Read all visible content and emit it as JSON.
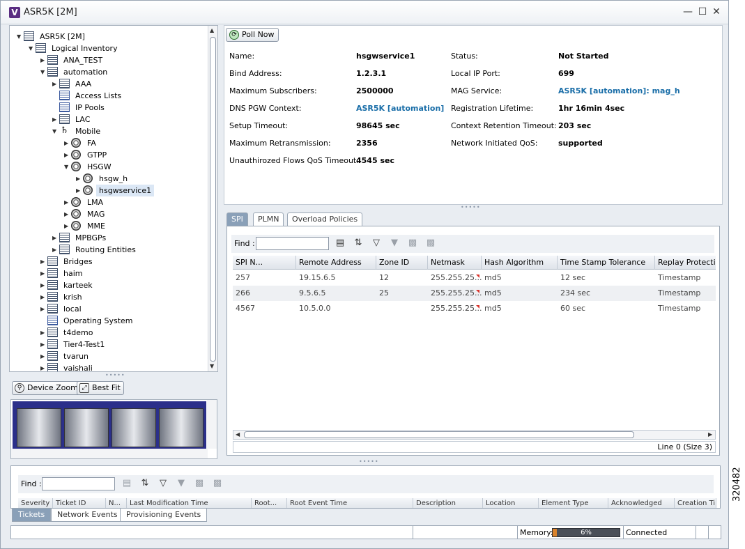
{
  "window": {
    "title": "ASR5K [2M]",
    "app_icon": "V"
  },
  "tree": {
    "items": [
      {
        "label": "ASR5K [2M]",
        "level": 0,
        "expanded": true,
        "icon": "device-icon"
      },
      {
        "label": "Logical Inventory",
        "level": 1,
        "expanded": true,
        "icon": "inventory-icon"
      },
      {
        "label": "ANA_TEST",
        "level": 2,
        "expanded": false,
        "icon": "context-icon"
      },
      {
        "label": "automation",
        "level": 2,
        "expanded": true,
        "icon": "context-icon"
      },
      {
        "label": "AAA",
        "level": 3,
        "expanded": false,
        "icon": "aaa-icon"
      },
      {
        "label": "Access Lists",
        "level": 3,
        "icon": "list-icon"
      },
      {
        "label": "IP Pools",
        "level": 3,
        "icon": "list-icon"
      },
      {
        "label": "LAC",
        "level": 3,
        "expanded": false,
        "icon": "context-icon"
      },
      {
        "label": "Mobile",
        "level": 3,
        "expanded": true,
        "icon": "mobile-icon"
      },
      {
        "label": "FA",
        "level": 4,
        "expanded": false,
        "icon": "service-icon"
      },
      {
        "label": "GTPP",
        "level": 4,
        "expanded": false,
        "icon": "service-icon"
      },
      {
        "label": "HSGW",
        "level": 4,
        "expanded": true,
        "icon": "service-icon"
      },
      {
        "label": "hsgw_h",
        "level": 5,
        "expanded": false,
        "icon": "service-icon"
      },
      {
        "label": "hsgwservice1",
        "level": 5,
        "expanded": false,
        "icon": "service-icon",
        "selected": true
      },
      {
        "label": "LMA",
        "level": 4,
        "expanded": false,
        "icon": "service-icon"
      },
      {
        "label": "MAG",
        "level": 4,
        "expanded": false,
        "icon": "service-icon"
      },
      {
        "label": "MME",
        "level": 4,
        "expanded": false,
        "icon": "service-icon"
      },
      {
        "label": "MPBGPs",
        "level": 3,
        "expanded": false,
        "icon": "context-icon"
      },
      {
        "label": "Routing Entities",
        "level": 3,
        "expanded": false,
        "icon": "context-icon"
      },
      {
        "label": "Bridges",
        "level": 2,
        "expanded": false,
        "icon": "context-icon"
      },
      {
        "label": "haim",
        "level": 2,
        "expanded": false,
        "icon": "context-icon"
      },
      {
        "label": "karteek",
        "level": 2,
        "expanded": false,
        "icon": "context-icon"
      },
      {
        "label": "krish",
        "level": 2,
        "expanded": false,
        "icon": "context-icon"
      },
      {
        "label": "local",
        "level": 2,
        "expanded": false,
        "icon": "context-icon"
      },
      {
        "label": "Operating System",
        "level": 2,
        "icon": "list-icon"
      },
      {
        "label": "t4demo",
        "level": 2,
        "expanded": false,
        "icon": "context-icon"
      },
      {
        "label": "Tier4-Test1",
        "level": 2,
        "expanded": false,
        "icon": "context-icon"
      },
      {
        "label": "tvarun",
        "level": 2,
        "expanded": false,
        "icon": "context-icon"
      },
      {
        "label": "vaishali",
        "level": 2,
        "expanded": false,
        "icon": "context-icon"
      }
    ]
  },
  "device_toolbar": {
    "zoom_label": "Device Zoom",
    "fit_label": "Best Fit"
  },
  "details": {
    "poll_label": "Poll Now",
    "left": [
      {
        "label": "Name:",
        "value": "hsgwservice1",
        "link": false
      },
      {
        "label": "Bind Address:",
        "value": "1.2.3.1",
        "link": false
      },
      {
        "label": "Maximum Subscribers:",
        "value": "2500000",
        "link": false
      },
      {
        "label": "DNS PGW Context:",
        "value": "ASR5K [automation]",
        "link": true
      },
      {
        "label": "Setup Timeout:",
        "value": "98645 sec",
        "link": false
      },
      {
        "label": "Maximum Retransmission:",
        "value": "2356",
        "link": false
      },
      {
        "label": "Unauthirozed Flows QoS Timeout:",
        "value": "4545 sec",
        "link": false
      }
    ],
    "right": [
      {
        "label": "Status:",
        "value": "Not Started",
        "link": false
      },
      {
        "label": "Local IP Port:",
        "value": "699",
        "link": false
      },
      {
        "label": "MAG Service:",
        "value": "ASR5K [automation]: mag_h",
        "link": true
      },
      {
        "label": "Registration Lifetime:",
        "value": "1hr 16min 4sec",
        "link": false
      },
      {
        "label": "Context Retention Timeout:",
        "value": "203 sec",
        "link": false
      },
      {
        "label": "Network Initiated QoS:",
        "value": "supported",
        "link": false
      }
    ]
  },
  "spi_panel": {
    "tabs": [
      "SPI",
      "PLMN",
      "Overload Policies"
    ],
    "active_tab": "SPI",
    "find_label": "Find :",
    "find_value": "",
    "columns": [
      "SPI N...",
      "Remote Address",
      "Zone ID",
      "Netmask",
      "Hash Algorithm",
      "Time Stamp Tolerance",
      "Replay Protection"
    ],
    "rows": [
      [
        "257",
        "19.15.6.5",
        "12",
        "255.255.25...",
        "md5",
        "12 sec",
        "Timestamp"
      ],
      [
        "266",
        "9.5.6.5",
        "25",
        "255.255.25...",
        "md5",
        "234 sec",
        "Timestamp"
      ],
      [
        "4567",
        "10.5.0.0",
        "",
        "255.255.25...",
        "md5",
        "60 sec",
        "Timestamp"
      ]
    ],
    "status": "Line 0 (Size 3)"
  },
  "events_panel": {
    "find_label": "Find :",
    "find_value": "",
    "columns": [
      "Severity",
      "Ticket ID",
      "N...",
      "Last Modification Time",
      "Root...",
      "Root Event Time",
      "Description",
      "Location",
      "Element Type",
      "Acknowledged",
      "Creation Time"
    ],
    "tabs": [
      "Tickets",
      "Network Events",
      "Provisioning Events"
    ],
    "active_tab": "Tickets"
  },
  "statusbar": {
    "memory_label": "Memory:",
    "memory_percent": 6,
    "memory_text": "6%",
    "connection": "Connected"
  },
  "figure_id": "320482",
  "colors": {
    "link": "#1a6ea8",
    "tab_active": "#8aa0b8",
    "memory_fill": "#d9822b"
  }
}
